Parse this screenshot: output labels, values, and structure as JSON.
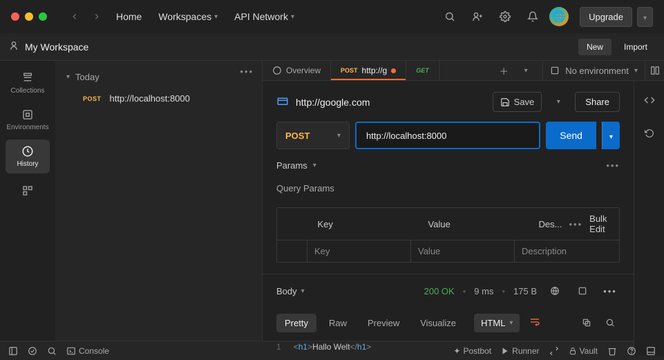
{
  "titlebar": {
    "home": "Home",
    "workspaces": "Workspaces",
    "api_network": "API Network",
    "upgrade": "Upgrade"
  },
  "workspace": {
    "name": "My Workspace",
    "new": "New",
    "import": "Import"
  },
  "rail": {
    "collections": "Collections",
    "environments": "Environments",
    "history": "History"
  },
  "history": {
    "group": "Today",
    "item_method": "POST",
    "item_url": "http://localhost:8000"
  },
  "tabs": {
    "overview": "Overview",
    "active_method": "POST",
    "active_label": "http://g",
    "get": "GET",
    "no_env": "No environment"
  },
  "request": {
    "title": "http://google.com",
    "save": "Save",
    "share": "Share",
    "method": "POST",
    "url": "http://localhost:8000",
    "send": "Send",
    "params": "Params",
    "query_params": "Query Params",
    "col_key": "Key",
    "col_value": "Value",
    "col_desc": "Des...",
    "ph_key": "Key",
    "ph_value": "Value",
    "ph_desc": "Description",
    "bulk_edit": "Bulk Edit"
  },
  "response": {
    "body": "Body",
    "status": "200 OK",
    "time": "9 ms",
    "size": "175 B",
    "pretty": "Pretty",
    "raw": "Raw",
    "preview": "Preview",
    "visualize": "Visualize",
    "format": "HTML",
    "line_no": "1",
    "tag": "h1",
    "content": "Hallo Welt"
  },
  "footer": {
    "console": "Console",
    "postbot": "Postbot",
    "runner": "Runner",
    "vault": "Vault"
  }
}
